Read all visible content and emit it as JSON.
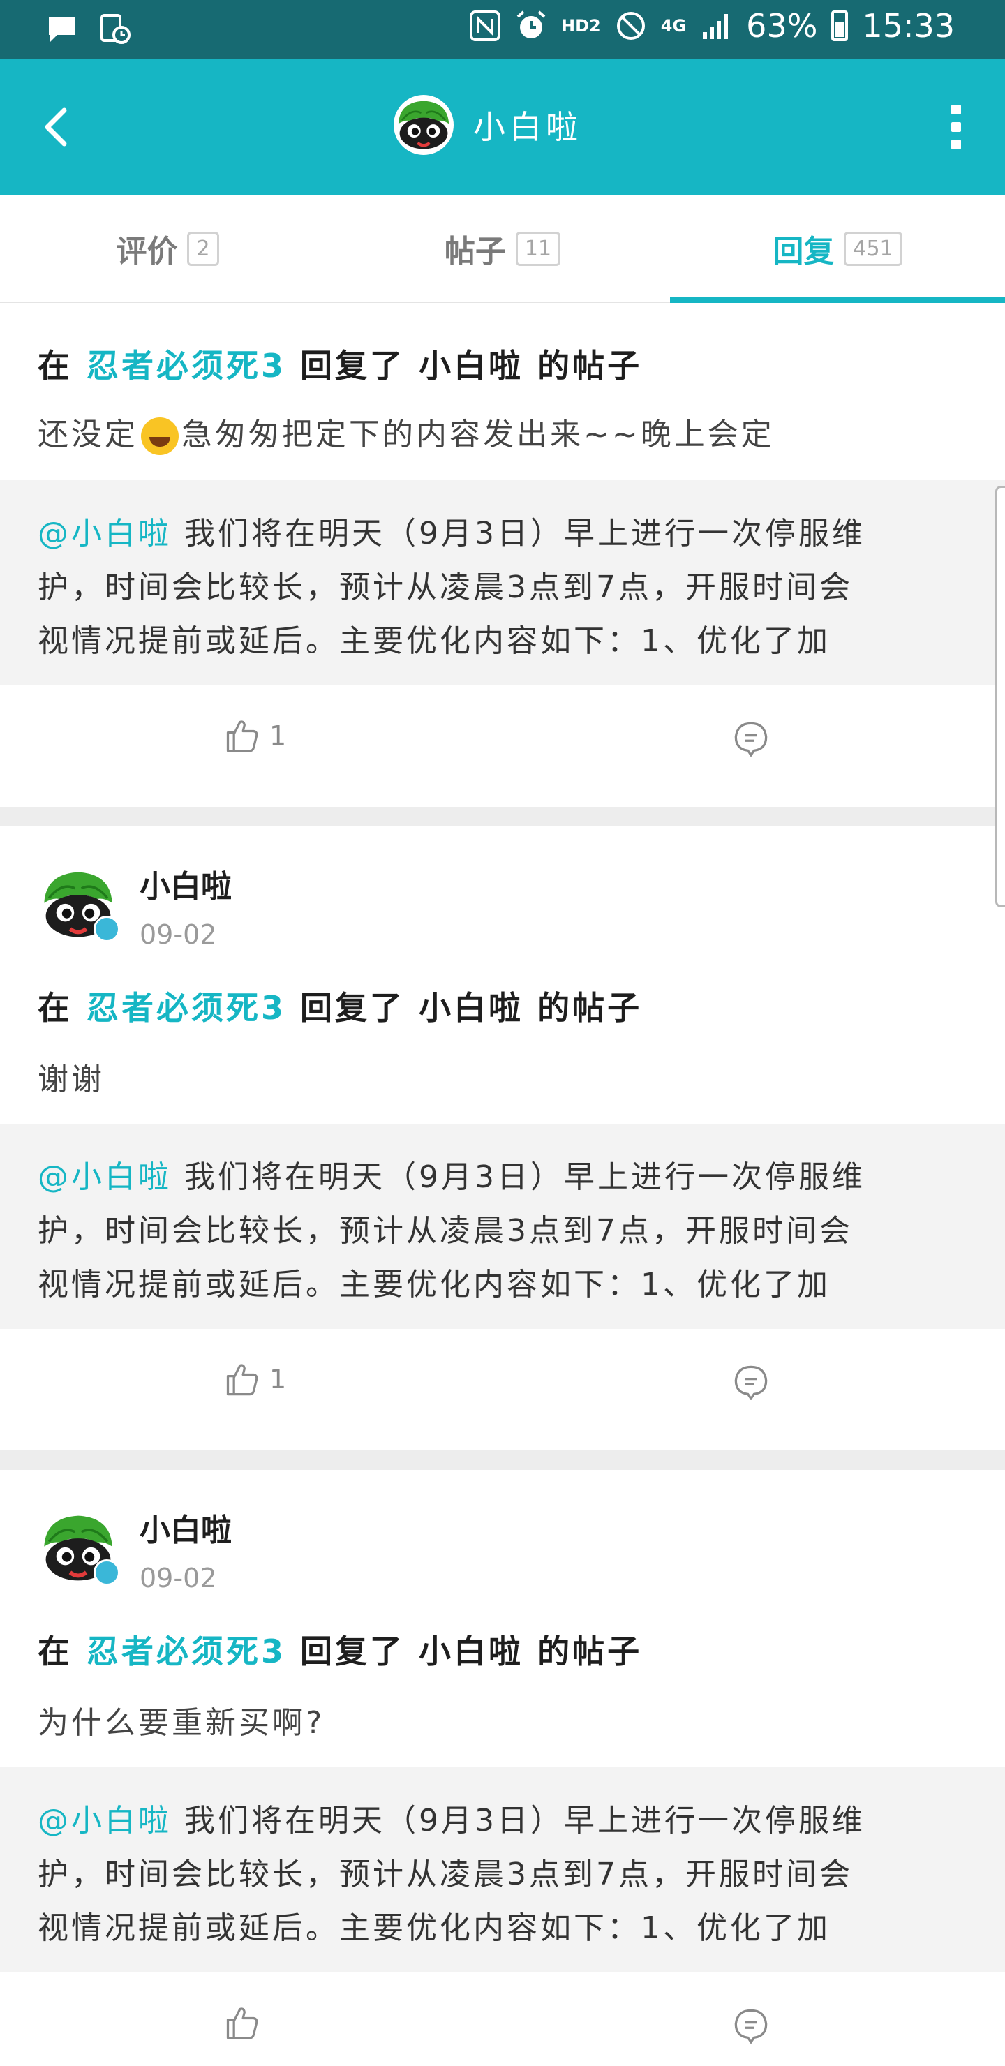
{
  "status_bar": {
    "network": "4G",
    "hd": "HD2",
    "battery": "63%",
    "time": "15:33"
  },
  "header": {
    "title": "小白啦"
  },
  "tabs": [
    {
      "label": "评价",
      "count": "2"
    },
    {
      "label": "帖子",
      "count": "11"
    },
    {
      "label": "回复",
      "count": "451"
    }
  ],
  "posts": [
    {
      "reply_prefix": "在",
      "game": "忍者必须死3",
      "reply_suffix": "回复了 小白啦 的帖子",
      "body_before": "还没定",
      "body_after": "急匆匆把定下的内容发出来~~晚上会定",
      "quote_mention": "@小白啦",
      "quote_line1": "我们将在明天（9月3日）早上进行一次停服维",
      "quote_line2": "护，时间会比较长，预计从凌晨3点到7点，开服时间会",
      "quote_line3": "视情况提前或延后。主要优化内容如下：1、优化了加",
      "likes": "1"
    },
    {
      "user": "小白啦",
      "date": "09-02",
      "reply_prefix": "在",
      "game": "忍者必须死3",
      "reply_suffix": "回复了 小白啦 的帖子",
      "body": "谢谢",
      "quote_mention": "@小白啦",
      "quote_line1": "我们将在明天（9月3日）早上进行一次停服维",
      "quote_line2": "护，时间会比较长，预计从凌晨3点到7点，开服时间会",
      "quote_line3": "视情况提前或延后。主要优化内容如下：1、优化了加",
      "likes": "1"
    },
    {
      "user": "小白啦",
      "date": "09-02",
      "reply_prefix": "在",
      "game": "忍者必须死3",
      "reply_suffix": "回复了 小白啦 的帖子",
      "body": "为什么要重新买啊?",
      "quote_mention": "@小白啦",
      "quote_line1": "我们将在明天（9月3日）早上进行一次停服维",
      "quote_line2": "护，时间会比较长，预计从凌晨3点到7点，开服时间会",
      "quote_line3": "视情况提前或延后。主要优化内容如下：1、优化了加",
      "likes": ""
    }
  ],
  "colors": {
    "accent": "#16b6c4",
    "status_bar": "#176a72",
    "quote_bg": "#f3f3f3"
  }
}
